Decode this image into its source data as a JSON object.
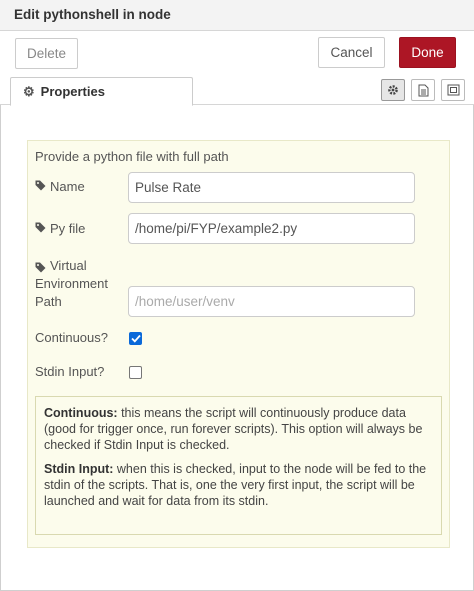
{
  "header": {
    "title": "Edit pythonshell in node"
  },
  "toolbar": {
    "delete_label": "Delete",
    "cancel_label": "Cancel",
    "done_label": "Done"
  },
  "tabs": {
    "properties_label": "Properties",
    "icons": [
      "gear-icon",
      "document-icon",
      "frame-icon"
    ]
  },
  "form": {
    "intro": "Provide a python file with full path",
    "name_label": "Name",
    "name_value": "Pulse Rate",
    "pyfile_label": "Py file",
    "pyfile_value": "/home/pi/FYP/example2.py",
    "venv_label_1": "Virtual",
    "venv_label_2": "Environment",
    "venv_label_3": "Path",
    "venv_placeholder": "/home/user/venv",
    "continuous_label": "Continuous?",
    "continuous_checked": true,
    "stdin_label": "Stdin Input?",
    "stdin_checked": false
  },
  "help": {
    "continuous_title": "Continuous:",
    "continuous_text": " this means the script will continuously produce data (good for trigger once, run forever scripts). This option will always be checked if Stdin Input is checked.",
    "stdin_title": "Stdin Input:",
    "stdin_text": " when this is checked, input to the node will be fed to the stdin of the scripts. That is, one the very first input, the script will be launched and wait for data from its stdin."
  },
  "colors": {
    "accent": "#ad1625",
    "checkbox": "#0b69d9",
    "panel_bg": "#fcfcec"
  }
}
